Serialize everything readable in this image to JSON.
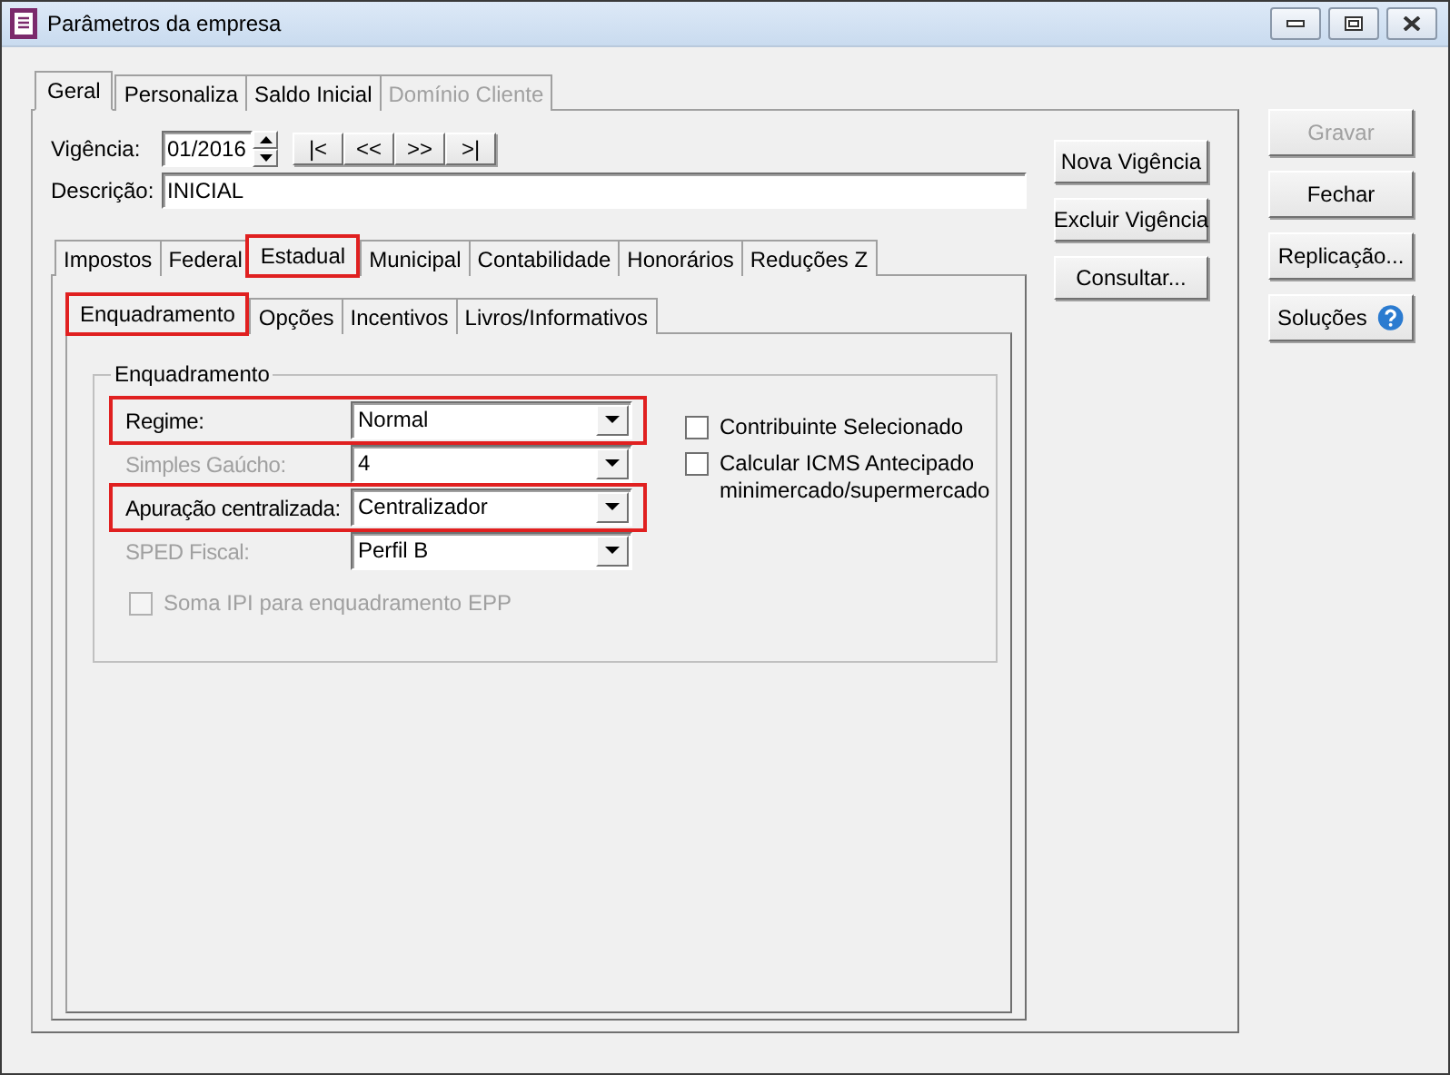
{
  "window": {
    "title": "Parâmetros da empresa"
  },
  "top_tabs": [
    {
      "label": "Geral",
      "selected": true,
      "disabled": false
    },
    {
      "label": "Personaliza",
      "selected": false,
      "disabled": false
    },
    {
      "label": "Saldo Inicial",
      "selected": false,
      "disabled": false
    },
    {
      "label": "Domínio Cliente",
      "selected": false,
      "disabled": true
    }
  ],
  "vigencia": {
    "label": "Vigência:",
    "value": "01/2016",
    "nav_buttons": [
      "|<",
      "<<",
      ">>",
      ">|"
    ]
  },
  "descricao": {
    "label": "Descrição:",
    "value": "INICIAL"
  },
  "vigencia_buttons": [
    {
      "label": "Nova Vigência"
    },
    {
      "label": "Excluir Vigência"
    },
    {
      "label": "Consultar..."
    }
  ],
  "section_tabs": [
    {
      "label": "Impostos",
      "selected": false,
      "highlighted": false
    },
    {
      "label": "Federal",
      "selected": false,
      "highlighted": false
    },
    {
      "label": "Estadual",
      "selected": true,
      "highlighted": true
    },
    {
      "label": "Municipal",
      "selected": false,
      "highlighted": false
    },
    {
      "label": "Contabilidade",
      "selected": false,
      "highlighted": false
    },
    {
      "label": "Honorários",
      "selected": false,
      "highlighted": false
    },
    {
      "label": "Reduções Z",
      "selected": false,
      "highlighted": false
    }
  ],
  "sub_tabs": [
    {
      "label": "Enquadramento",
      "selected": true,
      "highlighted": true
    },
    {
      "label": "Opções",
      "selected": false,
      "highlighted": false
    },
    {
      "label": "Incentivos",
      "selected": false,
      "highlighted": false
    },
    {
      "label": "Livros/Informativos",
      "selected": false,
      "highlighted": false
    }
  ],
  "group": {
    "title": "Enquadramento",
    "fields": [
      {
        "label": "Regime:",
        "value": "Normal",
        "disabled": false,
        "highlighted": true
      },
      {
        "label": "Simples Gaúcho:",
        "value": "4",
        "disabled": true,
        "highlighted": false
      },
      {
        "label": "Apuração centralizada:",
        "value": "Centralizador",
        "disabled": false,
        "highlighted": true
      },
      {
        "label": "SPED Fiscal:",
        "value": "Perfil B",
        "disabled": true,
        "highlighted": false
      }
    ],
    "options": [
      {
        "label": "Contribuinte Selecionado",
        "checked": false,
        "disabled": false
      },
      {
        "label": "Calcular ICMS Antecipado minimercado/supermercado",
        "checked": false,
        "disabled": false
      }
    ],
    "bottom_option": {
      "label": "Soma IPI para enquadramento EPP",
      "checked": false,
      "disabled": true
    }
  },
  "action_buttons": [
    {
      "label": "Gravar",
      "disabled": true,
      "kind": "plain"
    },
    {
      "label": "Fechar",
      "disabled": false,
      "kind": "plain"
    },
    {
      "label": "Replicação...",
      "disabled": false,
      "kind": "plain"
    },
    {
      "label": "Soluções",
      "disabled": false,
      "kind": "help"
    }
  ]
}
